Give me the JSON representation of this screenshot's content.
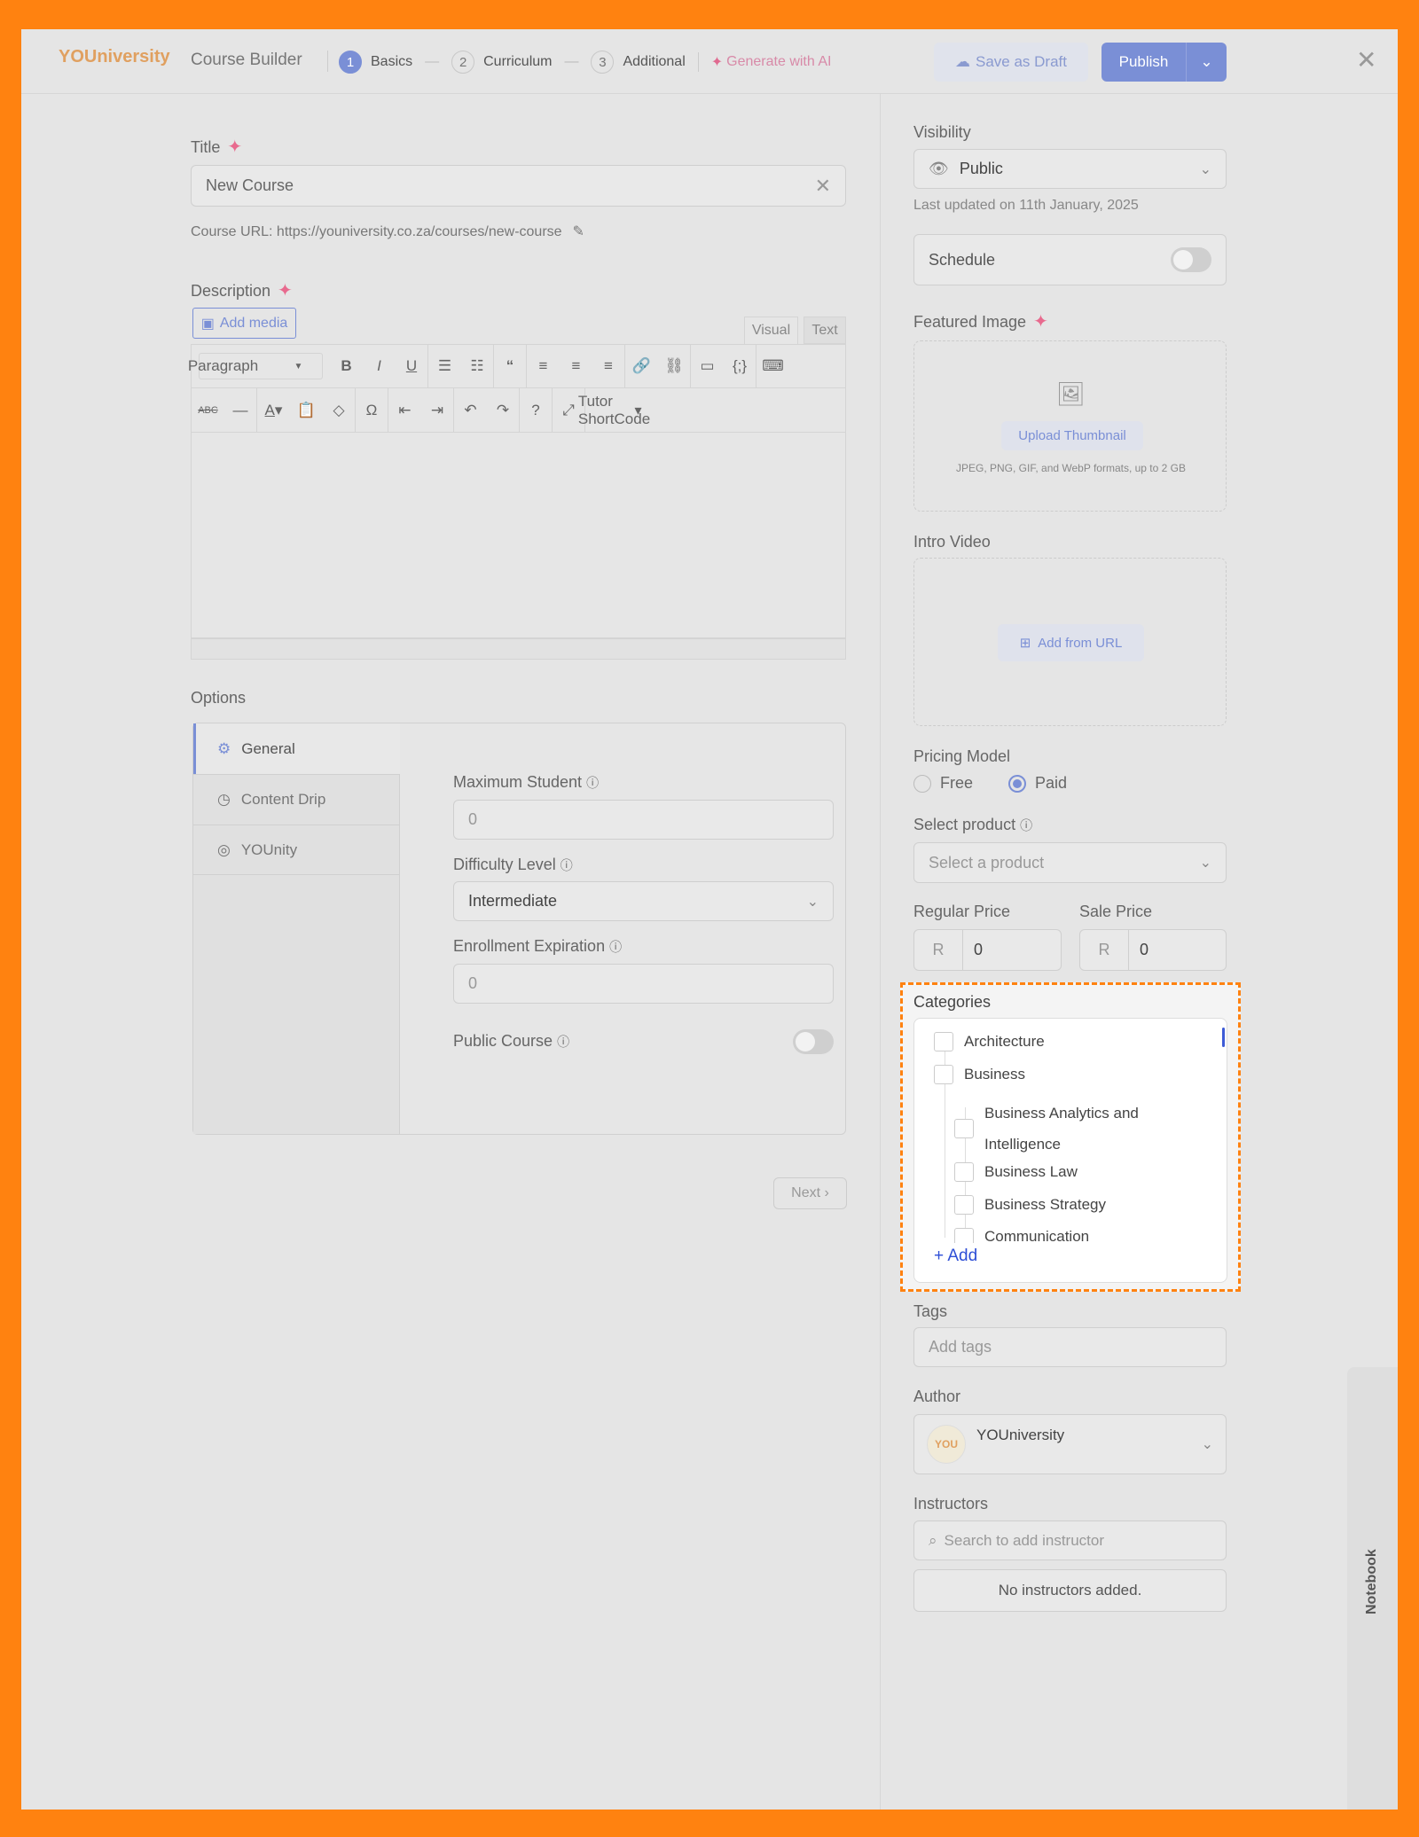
{
  "header": {
    "logo": "YOUniversity",
    "title": "Course Builder",
    "steps": [
      {
        "num": "1",
        "label": "Basics"
      },
      {
        "num": "2",
        "label": "Curriculum"
      },
      {
        "num": "3",
        "label": "Additional"
      }
    ],
    "generate_ai": "Generate with AI",
    "save_draft": "Save as Draft",
    "publish": "Publish"
  },
  "main": {
    "title_label": "Title",
    "title_value": "New Course",
    "course_url": "Course URL: https://youniversity.co.za/courses/new-course",
    "description_label": "Description",
    "add_media": "Add media",
    "tab_visual": "Visual",
    "tab_text": "Text",
    "format_select": "Paragraph",
    "shortcode": "Tutor ShortCode",
    "options_label": "Options",
    "option_tabs": [
      {
        "label": "General"
      },
      {
        "label": "Content Drip"
      },
      {
        "label": "YOUnity"
      }
    ],
    "max_student_label": "Maximum Student",
    "max_student_value": "0",
    "difficulty_label": "Difficulty Level",
    "difficulty_value": "Intermediate",
    "enroll_exp_label": "Enrollment Expiration",
    "enroll_exp_value": "0",
    "public_course_label": "Public Course",
    "public_course_on": false,
    "next": "Next"
  },
  "sidebar": {
    "visibility_label": "Visibility",
    "visibility_value": "Public",
    "last_updated": "Last updated on 11th January, 2025",
    "schedule_label": "Schedule",
    "schedule_on": false,
    "featured_label": "Featured Image",
    "upload_thumb": "Upload Thumbnail",
    "formats": "JPEG, PNG, GIF, and WebP formats, up to 2 GB",
    "intro_label": "Intro Video",
    "add_url": "Add from URL",
    "pricing_label": "Pricing Model",
    "pricing_free": "Free",
    "pricing_paid": "Paid",
    "pricing_selected": "Paid",
    "product_label": "Select product",
    "product_placeholder": "Select a product",
    "regular_label": "Regular Price",
    "sale_label": "Sale Price",
    "currency": "R",
    "regular_value": "0",
    "sale_value": "0",
    "categories_label": "Categories",
    "categories": [
      "Architecture",
      "Business",
      "Business Analytics and",
      "Intelligence",
      "Business Law",
      "Business Strategy",
      "Communication"
    ],
    "add_category": "Add",
    "tags_label": "Tags",
    "tags_placeholder": "Add tags",
    "author_label": "Author",
    "author_name": "YOUniversity",
    "author_avatar": "YOU",
    "instructors_label": "Instructors",
    "instructor_placeholder": "Search to add instructor",
    "no_instructors": "No instructors added.",
    "notebook": "Notebook"
  },
  "colors": {
    "accent": "#7a8fd6",
    "frame": "#ff8210",
    "highlight": "#ff8210"
  }
}
